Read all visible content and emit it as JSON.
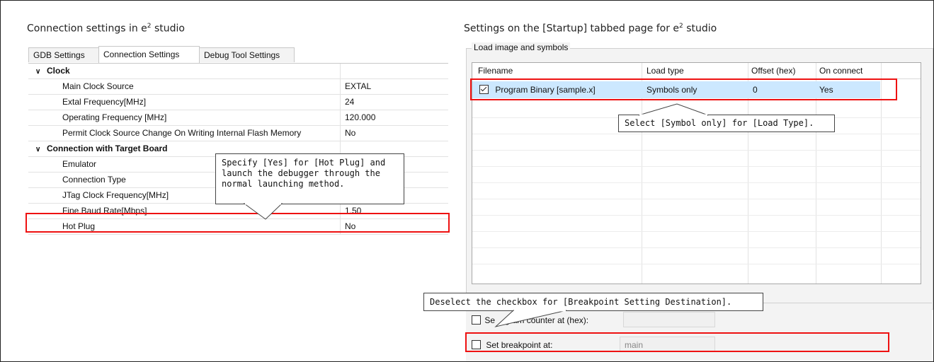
{
  "left": {
    "heading_prefix": "Connection settings in e",
    "heading_sup": "2",
    "heading_suffix": " studio",
    "tabs": [
      {
        "label": "GDB Settings"
      },
      {
        "label": "Connection Settings"
      },
      {
        "label": "Debug Tool Settings"
      }
    ],
    "groups": {
      "clock": "Clock",
      "target": "Connection with Target Board"
    },
    "rows": {
      "main_clock_source": {
        "name": "Main Clock Source",
        "value": "EXTAL"
      },
      "extal_frequency": {
        "name": "Extal Frequency[MHz]",
        "value": "24"
      },
      "operating_frequency": {
        "name": "Operating Frequency [MHz]",
        "value": "120.000"
      },
      "permit_clock": {
        "name": "Permit Clock Source Change On Writing Internal Flash Memory",
        "value": "No"
      },
      "emulator": {
        "name": "Emulator",
        "value": ""
      },
      "connection_type": {
        "name": "Connection Type",
        "value": ""
      },
      "jtag_clock": {
        "name": "JTag Clock Frequency[MHz]",
        "value": ""
      },
      "fine_baud": {
        "name": "Fine Baud Rate[Mbps]",
        "value": "1.50"
      },
      "hot_plug": {
        "name": "Hot Plug",
        "value": "No"
      }
    },
    "callout": {
      "line1": "Specify [Yes] for [Hot Plug] and",
      "line2": "launch the debugger through the",
      "line3": "normal launching method."
    }
  },
  "right": {
    "heading_prefix": "Settings on the [Startup] tabbed page for e",
    "heading_sup": "2",
    "heading_suffix": " studio",
    "group_title": "Load image and symbols",
    "columns": [
      "Filename",
      "Load type",
      "Offset (hex)",
      "On connect"
    ],
    "row": {
      "filename": "Program Binary [sample.x]",
      "load_type": "Symbols only",
      "offset": "0",
      "on_connect": "Yes",
      "checked": true
    },
    "callout_load_type": "Select [Symbol only] for [Load Type].",
    "callout_breakpoint": "Deselect the checkbox for [Breakpoint Setting Destination].",
    "set_pc_label": "Set program counter at (hex):",
    "set_pc_visible": "gram counter at (hex):",
    "set_pc_prefix": "Se",
    "set_breakpoint_label": "Set breakpoint at:",
    "set_breakpoint_value": "main"
  },
  "colors": {
    "highlight_red": "#e11111",
    "selection_blue": "#cce8ff"
  }
}
